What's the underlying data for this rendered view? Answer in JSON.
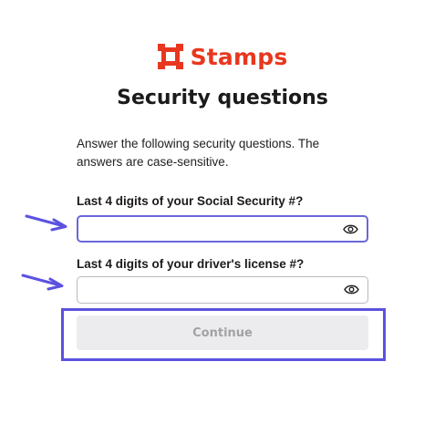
{
  "brand": {
    "name": "Stamps",
    "color": "#e8371f",
    "logo_icon": "stamp-frame-icon"
  },
  "page": {
    "title": "Security questions",
    "instructions": "Answer the following security questions. The answers are case-sensitive."
  },
  "fields": [
    {
      "label": "Last 4 digits of your Social Security #?",
      "value": "",
      "toggle_icon": "eye-icon",
      "focused": true
    },
    {
      "label": "Last 4 digits of your driver's license #?",
      "value": "",
      "toggle_icon": "eye-icon",
      "focused": false
    }
  ],
  "continue_button": {
    "label": "Continue",
    "disabled": true
  },
  "annotations": {
    "arrow_color": "#5b52e0",
    "highlight_color": "#5b52e0"
  }
}
